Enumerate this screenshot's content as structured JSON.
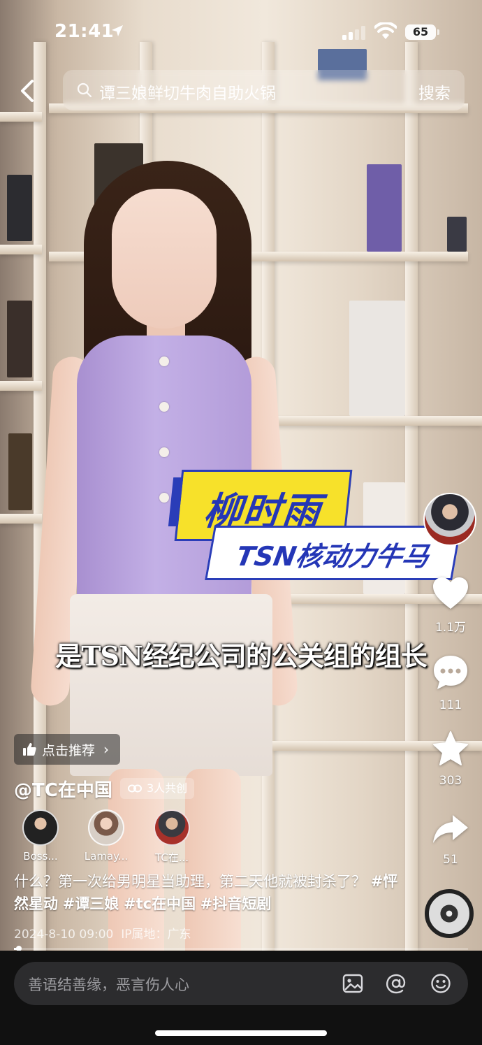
{
  "status_bar": {
    "time": "21:41",
    "battery": "65"
  },
  "search": {
    "query": "谭三娘鲜切牛肉自助火锅",
    "button_label": "搜索"
  },
  "video_overlay": {
    "name_card": "柳时雨",
    "tag_card": "TSN核动力牛马",
    "subtitle": "是TSN经纪公司的公关组的组长"
  },
  "actions": {
    "likes": "1.1万",
    "comments": "111",
    "favorites": "303",
    "shares": "51"
  },
  "recommend": {
    "label": "点击推荐"
  },
  "author": {
    "name": "@TC在中国",
    "cocreate": "3人共创"
  },
  "creators": [
    {
      "name": "Boss..."
    },
    {
      "name": "Lamay..."
    },
    {
      "name": "TC在..."
    }
  ],
  "description": {
    "text": "什么？第一次给男明星当助理，第二天他就被封杀了？",
    "tags": [
      "#怦然星动",
      "#谭三娘",
      "#tc在中国",
      "#抖音短剧"
    ]
  },
  "meta": {
    "date": "2024-8-10 09:00",
    "ip": "IP属地：广东"
  },
  "progress": {
    "fraction": 0.01
  },
  "comment": {
    "placeholder": "善语结善缘，恶言伤人心"
  },
  "colors": {
    "accent_yellow": "#f7e12a",
    "accent_blue": "#2436b6",
    "like_red": "#fe2c55"
  }
}
